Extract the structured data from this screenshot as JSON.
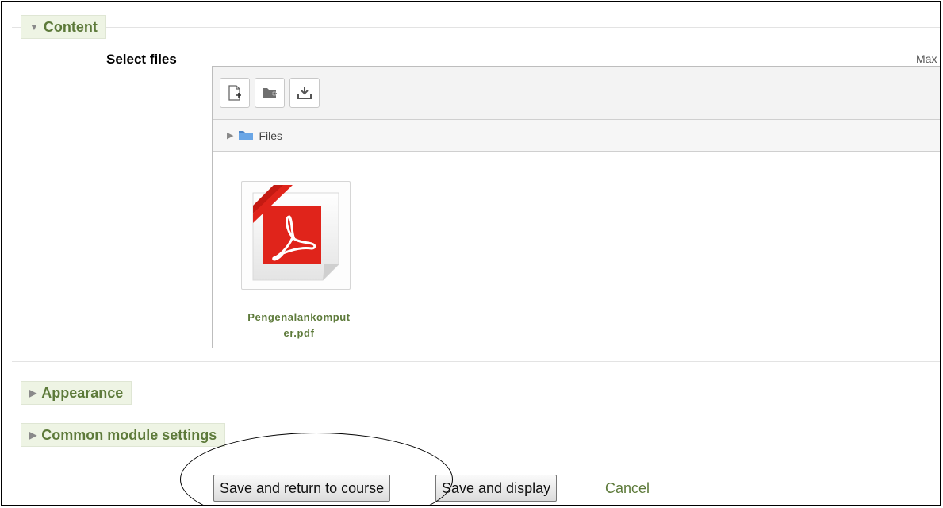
{
  "sections": {
    "content": {
      "label": "Content",
      "arrow": "▼"
    },
    "appearance": {
      "label": "Appearance",
      "arrow": "▶"
    },
    "common": {
      "label": "Common module settings",
      "arrow": "▶"
    }
  },
  "select_files": {
    "label": "Select files",
    "max_label": "Max"
  },
  "filemanager": {
    "toolbar": {
      "icons": [
        "add-file-icon",
        "create-folder-icon",
        "download-icon"
      ]
    },
    "path": {
      "arrow": "▶",
      "folder": "Files"
    },
    "file": {
      "name_line1": "Pengenalankomput",
      "name_line2": "er.pdf",
      "icon": "pdf-file-icon"
    }
  },
  "buttons": {
    "save_return": "Save and return to course",
    "save_display": "Save and display",
    "cancel": "Cancel"
  },
  "colors": {
    "accent_green": "#5d7a3a",
    "legend_bg": "#eef4e4",
    "pdf_red": "#e0241b"
  }
}
